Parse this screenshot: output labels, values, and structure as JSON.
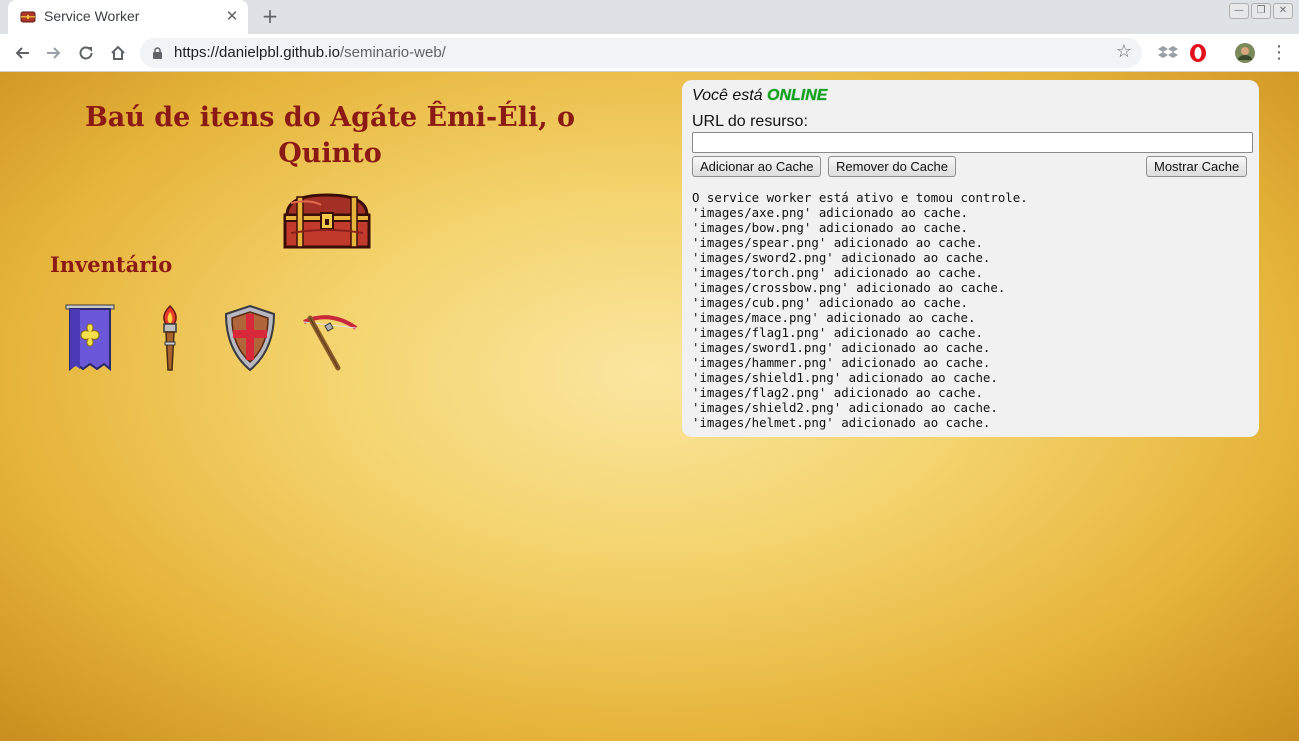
{
  "browser": {
    "tab_title": "Service Worker",
    "tab_close": "✕",
    "new_tab": "+",
    "url_host": "https://danielpbl.github.io",
    "url_path": "/seminario-web/",
    "window_controls": [
      "—",
      "❐",
      "✕"
    ]
  },
  "page": {
    "title": "Baú de itens do Agáte Êmi-Éli, o Quinto",
    "inventory_heading": "Inventário",
    "inventory_items": [
      "flag-icon",
      "torch-icon",
      "shield-icon",
      "crossbow-icon"
    ]
  },
  "panel": {
    "status_prefix": "Você está",
    "status_value": "ONLINE",
    "url_label": "URL do resurso:",
    "url_value": "",
    "add_button": "Adicionar ao Cache",
    "remove_button": "Remover do Cache",
    "show_button": "Mostrar Cache",
    "log": [
      "O service worker está ativo e tomou controle.",
      "'images/axe.png' adicionado ao cache.",
      "'images/bow.png' adicionado ao cache.",
      "'images/spear.png' adicionado ao cache.",
      "'images/sword2.png' adicionado ao cache.",
      "'images/torch.png' adicionado ao cache.",
      "'images/crossbow.png' adicionado ao cache.",
      "'images/cub.png' adicionado ao cache.",
      "'images/mace.png' adicionado ao cache.",
      "'images/flag1.png' adicionado ao cache.",
      "'images/sword1.png' adicionado ao cache.",
      "'images/hammer.png' adicionado ao cache.",
      "'images/shield1.png' adicionado ao cache.",
      "'images/flag2.png' adicionado ao cache.",
      "'images/shield2.png' adicionado ao cache.",
      "'images/helmet.png' adicionado ao cache."
    ]
  },
  "colors": {
    "title_red": "#8a1a13",
    "online_green": "#18a018",
    "panel_bg": "#f1f1f1"
  }
}
